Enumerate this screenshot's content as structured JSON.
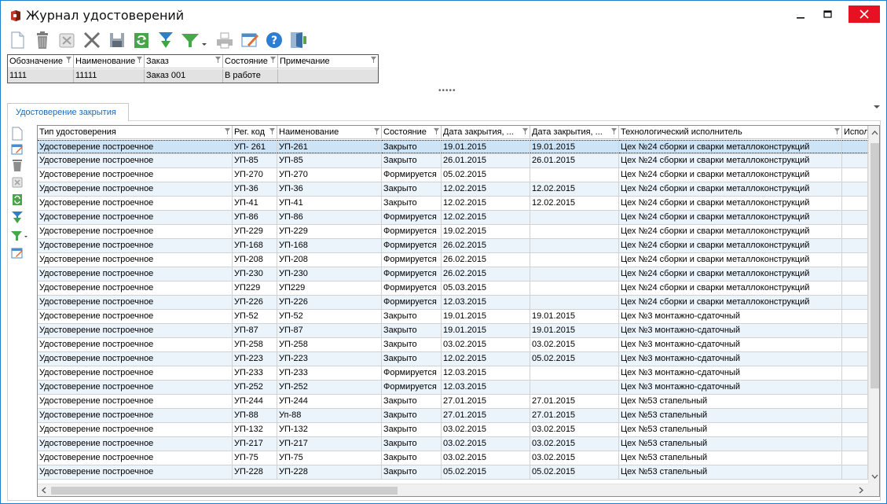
{
  "window": {
    "title": "Журнал удостоверений"
  },
  "toolbar": {
    "icons": [
      "new-document-icon",
      "delete-icon",
      "cancel-icon",
      "close-x-icon",
      "save-icon",
      "refresh-icon",
      "import-icon",
      "filter-icon",
      "print-icon",
      "edit-icon",
      "help-icon",
      "exit-icon"
    ]
  },
  "master": {
    "columns": [
      "Обозначение",
      "Наименование",
      "Заказ",
      "Состояние",
      "Примечание"
    ],
    "row": [
      "1111",
      "11111",
      "Заказ 001",
      "В работе",
      ""
    ]
  },
  "splitter": "•••••",
  "tab": {
    "label": "Удостоверение закрытия"
  },
  "sidebar": {
    "icons": [
      "new-document-icon",
      "edit-icon",
      "delete-icon",
      "cancel-icon",
      "refresh-icon",
      "import-icon",
      "filter-icon",
      "edit-icon"
    ]
  },
  "grid": {
    "columns": [
      "Тип удостоверения",
      "Рег. код",
      "Наименование",
      "Состояние",
      "Дата закрытия, ...",
      "Дата закрытия, ...",
      "Технологический исполнитель",
      "Испол"
    ],
    "selected_row": 0,
    "rows": [
      [
        "Удостоверение построечное",
        "УП- 261",
        "УП-261",
        "Закрыто",
        "19.01.2015",
        "19.01.2015",
        "Цех №24 сборки и сварки металлоконструкций",
        ""
      ],
      [
        "Удостоверение построечное",
        "УП-85",
        "УП-85",
        "Закрыто",
        "26.01.2015",
        "26.01.2015",
        "Цех №24 сборки и сварки металлоконструкций",
        ""
      ],
      [
        "Удостоверение построечное",
        "УП-270",
        "УП-270",
        "Формируется",
        "05.02.2015",
        "",
        "Цех №24 сборки и сварки металлоконструкций",
        ""
      ],
      [
        "Удостоверение построечное",
        "УП-36",
        "УП-36",
        "Закрыто",
        "12.02.2015",
        "12.02.2015",
        "Цех №24 сборки и сварки металлоконструкций",
        ""
      ],
      [
        "Удостоверение построечное",
        "УП-41",
        "УП-41",
        "Закрыто",
        "12.02.2015",
        "12.02.2015",
        "Цех №24 сборки и сварки металлоконструкций",
        ""
      ],
      [
        "Удостоверение построечное",
        "УП-86",
        "УП-86",
        "Формируется",
        "12.02.2015",
        "",
        "Цех №24 сборки и сварки металлоконструкций",
        ""
      ],
      [
        "Удостоверение построечное",
        "УП-229",
        "УП-229",
        "Формируется",
        "19.02.2015",
        "",
        "Цех №24 сборки и сварки металлоконструкций",
        ""
      ],
      [
        "Удостоверение построечное",
        "УП-168",
        "УП-168",
        "Формируется",
        "26.02.2015",
        "",
        "Цех №24 сборки и сварки металлоконструкций",
        ""
      ],
      [
        "Удостоверение построечное",
        "УП-208",
        "УП-208",
        "Формируется",
        "26.02.2015",
        "",
        "Цех №24 сборки и сварки металлоконструкций",
        ""
      ],
      [
        "Удостоверение построечное",
        "УП-230",
        "УП-230",
        "Формируется",
        "26.02.2015",
        "",
        "Цех №24 сборки и сварки металлоконструкций",
        ""
      ],
      [
        "Удостоверение построечное",
        "УП229",
        "УП229",
        "Формируется",
        "05.03.2015",
        "",
        "Цех №24 сборки и сварки металлоконструкций",
        ""
      ],
      [
        "Удостоверение построечное",
        "УП-226",
        "УП-226",
        "Формируется",
        "12.03.2015",
        "",
        "Цех №24 сборки и сварки металлоконструкций",
        ""
      ],
      [
        "Удостоверение построечное",
        "УП-52",
        "УП-52",
        "Закрыто",
        "19.01.2015",
        "19.01.2015",
        "Цех №3 монтажно-сдаточный",
        ""
      ],
      [
        "Удостоверение построечное",
        "УП-87",
        "УП-87",
        "Закрыто",
        "19.01.2015",
        "19.01.2015",
        "Цех №3 монтажно-сдаточный",
        ""
      ],
      [
        "Удостоверение построечное",
        "УП-258",
        "УП-258",
        "Закрыто",
        "03.02.2015",
        "03.02.2015",
        "Цех №3 монтажно-сдаточный",
        ""
      ],
      [
        "Удостоверение построечное",
        "УП-223",
        "УП-223",
        "Закрыто",
        "12.02.2015",
        "05.02.2015",
        "Цех №3 монтажно-сдаточный",
        ""
      ],
      [
        "Удостоверение построечное",
        "УП-233",
        "УП-233",
        "Формируется",
        "12.03.2015",
        "",
        "Цех №3 монтажно-сдаточный",
        ""
      ],
      [
        "Удостоверение построечное",
        "УП-252",
        "УП-252",
        "Формируется",
        "12.03.2015",
        "",
        "Цех №3 монтажно-сдаточный",
        ""
      ],
      [
        "Удостоверение построечное",
        "УП-244",
        "УП-244",
        "Закрыто",
        "27.01.2015",
        "27.01.2015",
        "Цех №53 стапельный",
        ""
      ],
      [
        "Удостоверение построечное",
        "УП-88",
        "Уп-88",
        "Закрыто",
        "27.01.2015",
        "27.01.2015",
        "Цех №53 стапельный",
        ""
      ],
      [
        "Удостоверение построечное",
        "УП-132",
        "УП-132",
        "Закрыто",
        "03.02.2015",
        "03.02.2015",
        "Цех №53 стапельный",
        ""
      ],
      [
        "Удостоверение построечное",
        "УП-217",
        "УП-217",
        "Закрыто",
        "03.02.2015",
        "03.02.2015",
        "Цех №53 стапельный",
        ""
      ],
      [
        "Удостоверение построечное",
        "УП-75",
        "УП-75",
        "Закрыто",
        "03.02.2015",
        "03.02.2015",
        "Цех №53 стапельный",
        ""
      ],
      [
        "Удостоверение построечное",
        "УП-228",
        "УП-228",
        "Закрыто",
        "05.02.2015",
        "05.02.2015",
        "Цех №53 стапельный",
        ""
      ]
    ]
  },
  "colors": {
    "window_border": "#1e7fd0",
    "close_button": "#e81123",
    "row_alt": "#ebf3fb",
    "row_selected": "#cde4f7",
    "tab_text": "#1b6ab9"
  }
}
